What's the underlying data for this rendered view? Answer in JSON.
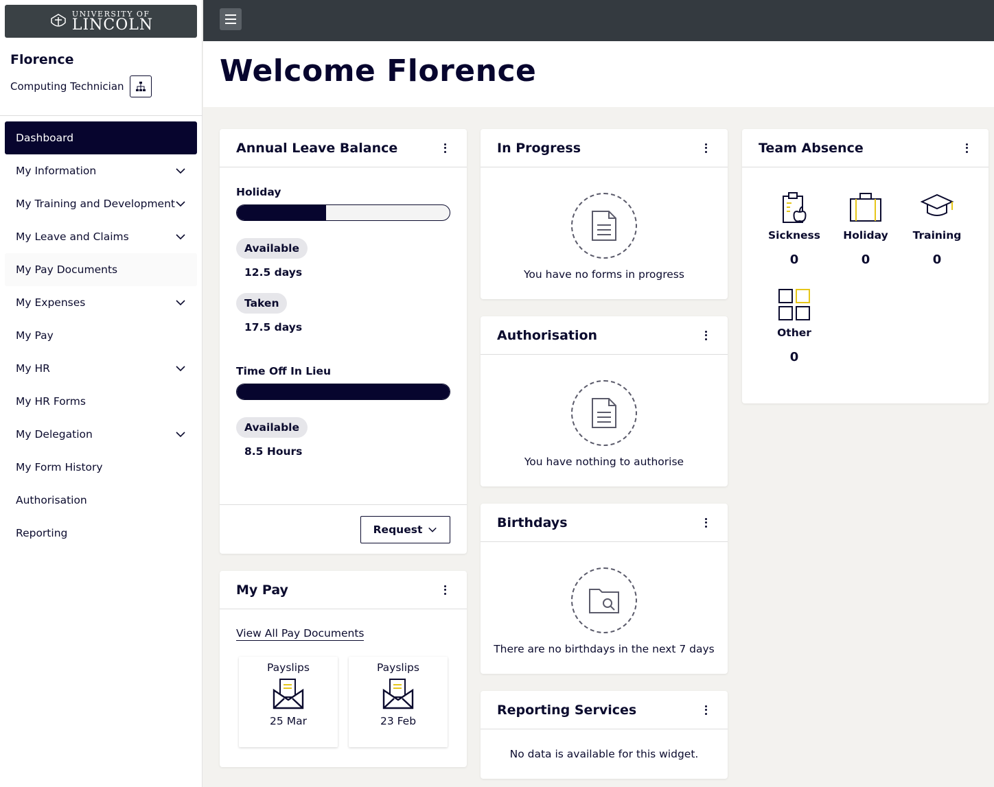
{
  "brand": {
    "small": "UNIVERSITY OF",
    "big": "LINCOLN"
  },
  "user": {
    "name": "Florence",
    "role": "Computing Technician"
  },
  "nav": [
    {
      "label": "Dashboard"
    },
    {
      "label": "My Information"
    },
    {
      "label": "My Training and Development"
    },
    {
      "label": "My Leave and Claims"
    },
    {
      "label": "My Pay Documents"
    },
    {
      "label": "My Expenses"
    },
    {
      "label": "My Pay"
    },
    {
      "label": "My HR"
    },
    {
      "label": "My HR Forms"
    },
    {
      "label": "My Delegation"
    },
    {
      "label": "My Form History"
    },
    {
      "label": "Authorisation"
    },
    {
      "label": "Reporting"
    }
  ],
  "welcome": "Welcome Florence",
  "leave": {
    "title": "Annual Leave Balance",
    "holiday_label": "Holiday",
    "holiday_fraction": 0.42,
    "available_label": "Available",
    "available_value": "12.5 days",
    "taken_label": "Taken",
    "taken_value": "17.5 days",
    "toil_label": "Time Off In Lieu",
    "toil_fraction": 1.0,
    "toil_available_label": "Available",
    "toil_available_value": "8.5 Hours",
    "request_label": "Request"
  },
  "in_progress": {
    "title": "In Progress",
    "empty": "You have no forms in progress"
  },
  "authorisation": {
    "title": "Authorisation",
    "empty": "You have nothing to authorise"
  },
  "birthdays": {
    "title": "Birthdays",
    "empty": "There are no birthdays in the next 7 days"
  },
  "reporting": {
    "title": "Reporting Services",
    "empty": "No data is available for this widget."
  },
  "team_absence": {
    "title": "Team Absence",
    "items": [
      {
        "label": "Sickness",
        "count": "0"
      },
      {
        "label": "Holiday",
        "count": "0"
      },
      {
        "label": "Training",
        "count": "0"
      },
      {
        "label": "Other",
        "count": "0"
      }
    ]
  },
  "my_pay": {
    "title": "My Pay",
    "link": "View All Pay Documents",
    "slips": [
      {
        "title": "Payslips",
        "date": "25 Mar"
      },
      {
        "title": "Payslips",
        "date": "23 Feb"
      }
    ]
  },
  "colors": {
    "navy": "#07052e",
    "accent_yellow": "#e6c619",
    "topbar": "#343a40"
  }
}
